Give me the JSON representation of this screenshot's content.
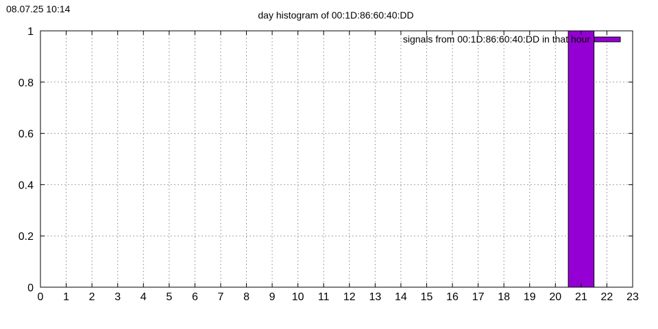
{
  "timestamp": "08.07.25 10:14",
  "chart_data": {
    "type": "bar",
    "title": "day histogram of 00:1D:86:60:40:DD",
    "xlabel": "",
    "ylabel": "",
    "xlim": [
      0,
      23
    ],
    "ylim": [
      0,
      1
    ],
    "x_ticks": [
      "0",
      "1",
      "2",
      "3",
      "4",
      "5",
      "6",
      "7",
      "8",
      "9",
      "10",
      "11",
      "12",
      "13",
      "14",
      "15",
      "16",
      "17",
      "18",
      "19",
      "20",
      "21",
      "22",
      "23"
    ],
    "y_ticks": [
      "0",
      "0.2",
      "0.4",
      "0.6",
      "0.8",
      "1"
    ],
    "grid": true,
    "legend_position": "top-right",
    "series": [
      {
        "name": "signals from 00:1D:86:60:40:DD in that hour",
        "color": "#9400d3",
        "x": [
          21
        ],
        "values": [
          1
        ]
      }
    ]
  }
}
